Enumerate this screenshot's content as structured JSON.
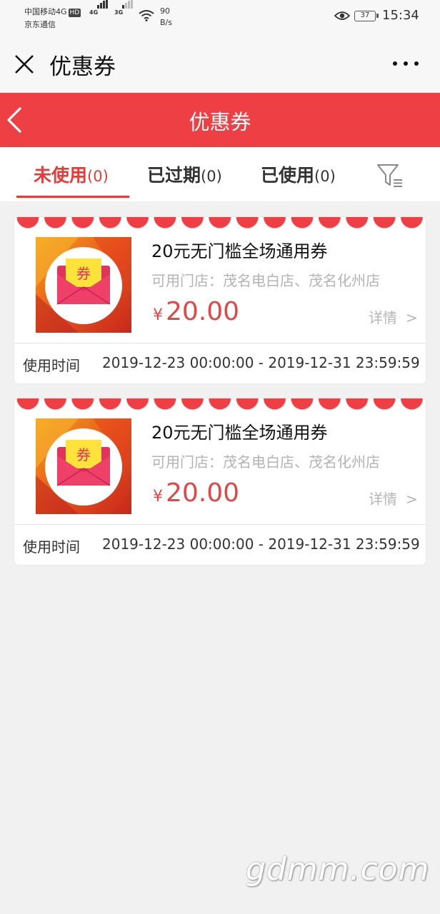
{
  "status_bar": {
    "carrier_line1": "中国移动4G",
    "hd_badge": "HD",
    "carrier_line2": "京东通信",
    "net_type_1": "4G",
    "net_type_2": "3G",
    "speed_value": "90",
    "speed_unit": "B/s",
    "battery": "37",
    "time": "15:34"
  },
  "top_bar": {
    "title": "优惠券"
  },
  "header": {
    "title": "优惠券",
    "color": "#ee3f44"
  },
  "tabs": [
    {
      "label": "未使用",
      "count": "(0)",
      "active": true
    },
    {
      "label": "已过期",
      "count": "(0)",
      "active": false
    },
    {
      "label": "已使用",
      "count": "(0)",
      "active": false
    }
  ],
  "coupons": [
    {
      "thumb_label": "券",
      "title": "20元无门槛全场通用券",
      "stores": "可用门店：茂名电白店、茂名化州店",
      "currency": "¥",
      "amount": "20.00",
      "detail_label": "详情",
      "detail_arrow": ">",
      "time_label": "使用时间",
      "time_range": "2019-12-23 00:00:00 - 2019-12-31 23:59:59"
    },
    {
      "thumb_label": "券",
      "title": "20元无门槛全场通用券",
      "stores": "可用门店：茂名电白店、茂名化州店",
      "currency": "¥",
      "amount": "20.00",
      "detail_label": "详情",
      "detail_arrow": ">",
      "time_label": "使用时间",
      "time_range": "2019-12-23 00:00:00 - 2019-12-31 23:59:59"
    }
  ],
  "watermark": "gdmm.com",
  "colors": {
    "accent_red": "#e53b3b",
    "price_red": "#e04848",
    "background": "#f1f1f1"
  }
}
